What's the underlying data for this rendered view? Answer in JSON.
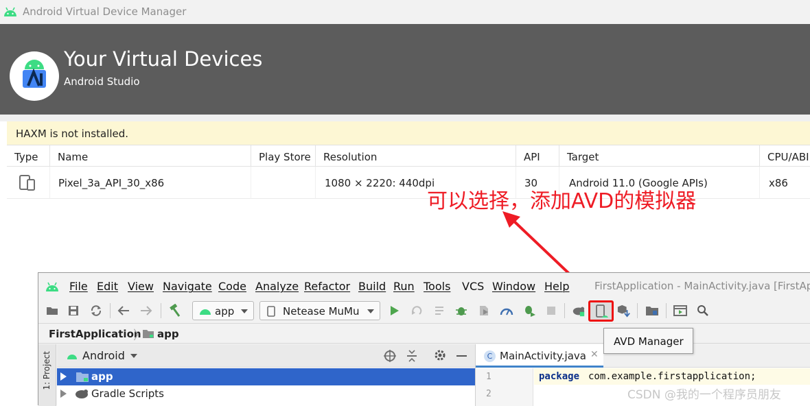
{
  "avd_window": {
    "title": "Android Virtual Device Manager",
    "header_title": "Your Virtual Devices",
    "header_subtitle": "Android Studio",
    "warning": "HAXM is not installed.",
    "columns": [
      "Type",
      "Name",
      "Play Store",
      "Resolution",
      "API",
      "Target",
      "CPU/ABI"
    ],
    "devices": [
      {
        "type_icon": "phone-tablet-icon",
        "name": "Pixel_3a_API_30_x86",
        "play_store": "",
        "resolution": "1080 × 2220: 440dpi",
        "api": "30",
        "target": "Android 11.0 (Google APIs)",
        "cpu_abi": "x86"
      }
    ]
  },
  "annotation": {
    "text": "可以选择，添加AVD的模拟器",
    "color": "#ee1c25"
  },
  "ide": {
    "menu": [
      "File",
      "Edit",
      "View",
      "Navigate",
      "Code",
      "Analyze",
      "Refactor",
      "Build",
      "Run",
      "Tools",
      "VCS",
      "Window",
      "Help"
    ],
    "window_title": "FirstApplication - MainActivity.java [FirstApp",
    "run_config": "app",
    "device": "Netease MuMu",
    "tooltip": "AVD Manager",
    "breadcrumb": {
      "project": "FirstApplication",
      "module": "app"
    },
    "side_tab": "1: Project",
    "project_view": "Android",
    "tree": [
      {
        "label": "app",
        "selected": true
      },
      {
        "label": "Gradle Scripts",
        "selected": false
      }
    ],
    "editor_tab": "MainActivity.java",
    "editor_tab_icon_letter": "C",
    "code": {
      "line_numbers": [
        "1",
        "2"
      ],
      "keyword": "package",
      "text": "com.example.firstapplication;"
    }
  },
  "watermark": "CSDN @我的一个程序员朋友",
  "colors": {
    "android_green": "#3ddc84",
    "header_bg": "#5c5c5c",
    "selection_blue": "#2f65ca",
    "highlight_red": "#e11111"
  }
}
